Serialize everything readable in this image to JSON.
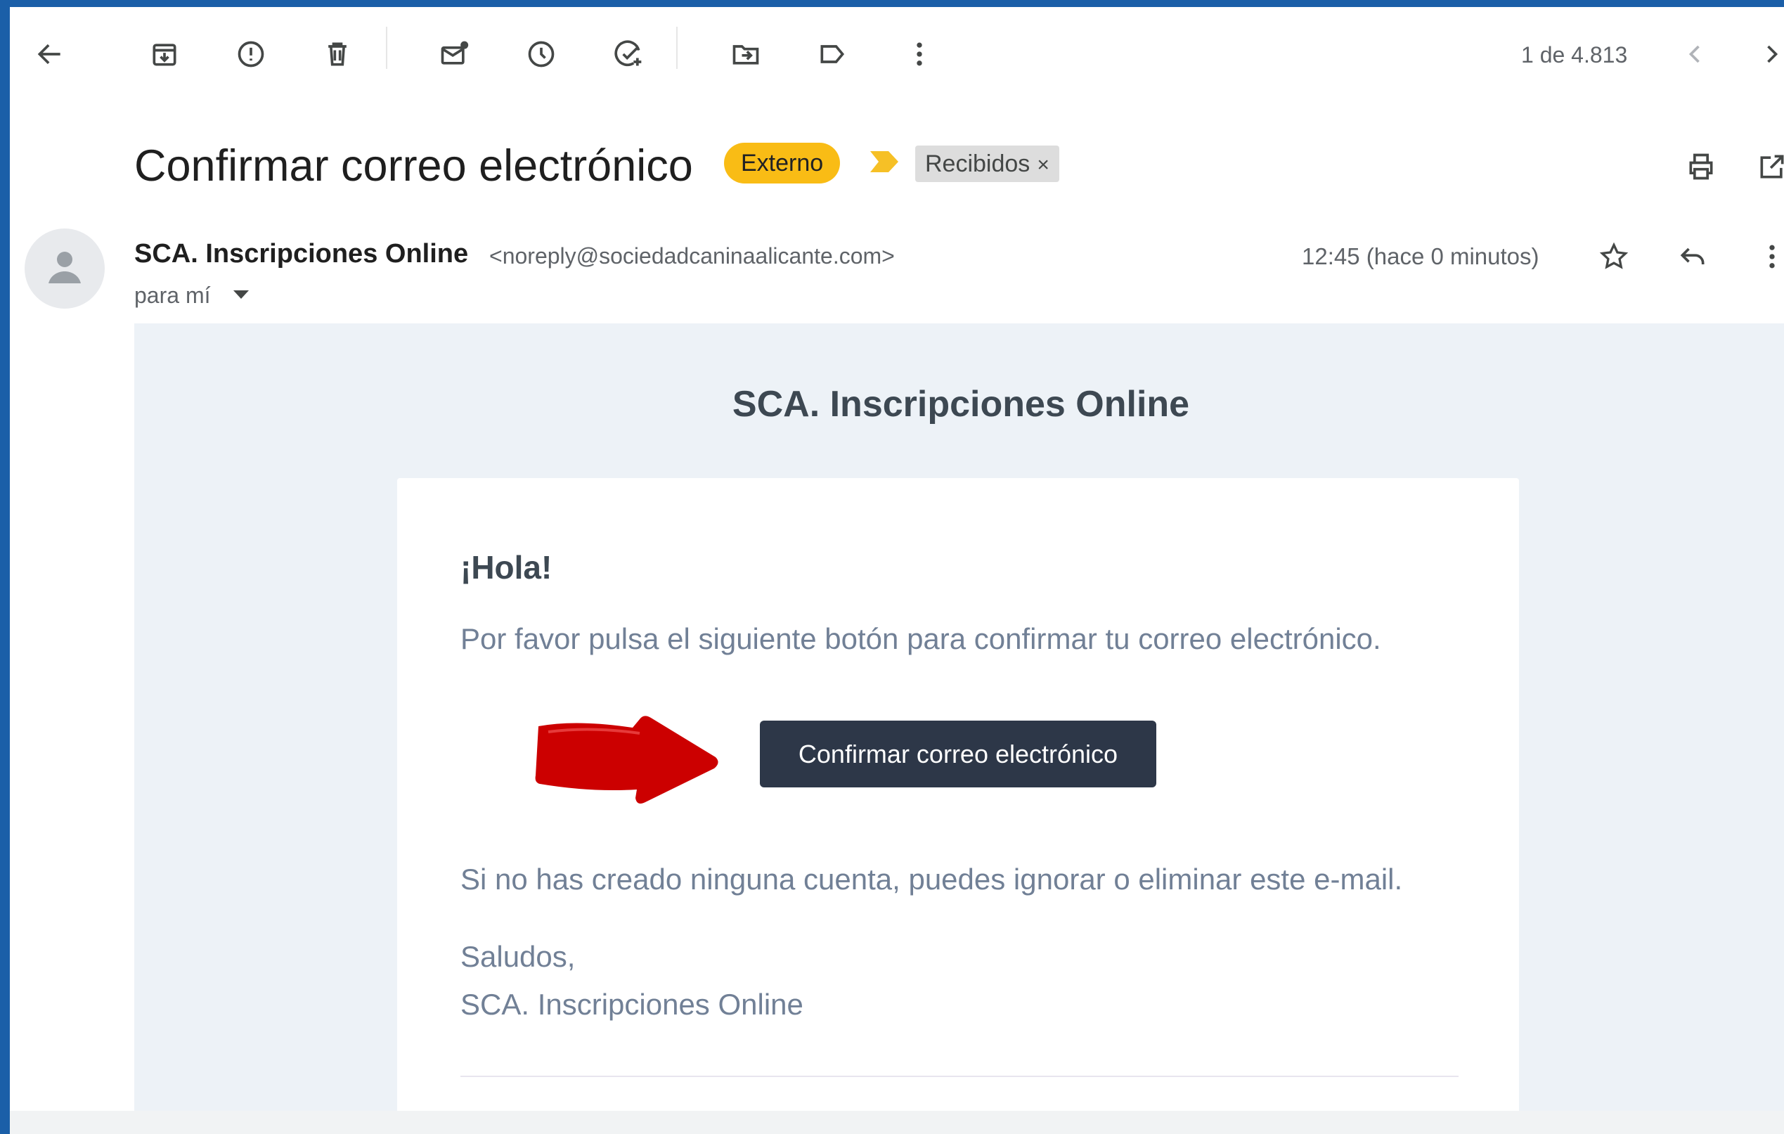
{
  "toolbar": {
    "counter": "1 de 4.813"
  },
  "message": {
    "subject": "Confirmar correo electrónico",
    "labels": {
      "external": "Externo",
      "inbox": "Recibidos",
      "inbox_remove": "×"
    },
    "sender_name": "SCA. Inscripciones Online",
    "sender_email": "<noreply@sociedadcaninaalicante.com>",
    "to": "para mí",
    "time": "12:45 (hace 0 minutos)"
  },
  "email_content": {
    "brand_title": "SCA. Inscripciones Online",
    "greeting": "¡Hola!",
    "intro": "Por favor pulsa el siguiente botón para confirmar tu correo electrónico.",
    "button_label": "Confirmar correo electrónico",
    "disclaimer": "Si no has creado ninguna cuenta, puedes ignorar o eliminar este e-mail.",
    "salutation": "Saludos,",
    "signature": "SCA. Inscripciones Online"
  },
  "icons": [
    "back-arrow-icon",
    "archive-icon",
    "report-spam-icon",
    "trash-icon",
    "mark-unread-icon",
    "snooze-icon",
    "add-task-icon",
    "move-to-icon",
    "label-icon",
    "more-vert-icon",
    "chevron-left-icon",
    "chevron-right-icon",
    "print-icon",
    "open-new-window-icon",
    "star-icon",
    "reply-icon",
    "importance-marker-icon",
    "avatar-icon",
    "arrow-pointer-icon"
  ],
  "colors": {
    "frame": "#1b5fa8",
    "external_chip": "#f9bc15",
    "importance_marker": "#f6c026",
    "email_background": "#edf2f7",
    "button": "#2d3748",
    "annotation_arrow": "#cc0000"
  }
}
